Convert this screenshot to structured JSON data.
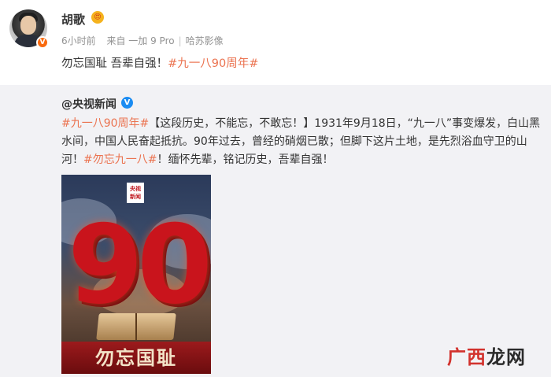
{
  "post": {
    "username": "胡歌",
    "verify_badge": "V",
    "emoji_badge": "😍",
    "meta": {
      "time": "6小时前",
      "source": "来自 一加 9 Pro",
      "location": "哈苏影像"
    },
    "text": "勿忘国耻 吾辈自强！",
    "hashtag": "#九一八90周年#"
  },
  "repost": {
    "author": "@央视新闻",
    "verify_badge": "V",
    "hashtag_start": "#九一八90周年#",
    "body_main": "【这段历史，不能忘，不敢忘！】1931年9月18日，“九一八”事变爆发，白山黑水间，中国人民奋起抵抗。90年过去，曾经的硝烟已散；但脚下这片土地，是先烈浴血守卫的山河！",
    "hashtag_end": "#勿忘九一八#",
    "body_tail": "！缅怀先辈，铭记历史，吾辈自强！",
    "poster": {
      "logo_line1": "央视",
      "logo_line2": "新闻",
      "number": "90",
      "banner": "勿忘国耻"
    }
  },
  "watermark": {
    "part1": "广西",
    "part2": "龙网"
  },
  "colors": {
    "hashtag": "#eb7350",
    "repost_bg": "#f2f2f5",
    "verify_blue": "#1b8cf2",
    "verify_orange": "#f96a0e"
  }
}
